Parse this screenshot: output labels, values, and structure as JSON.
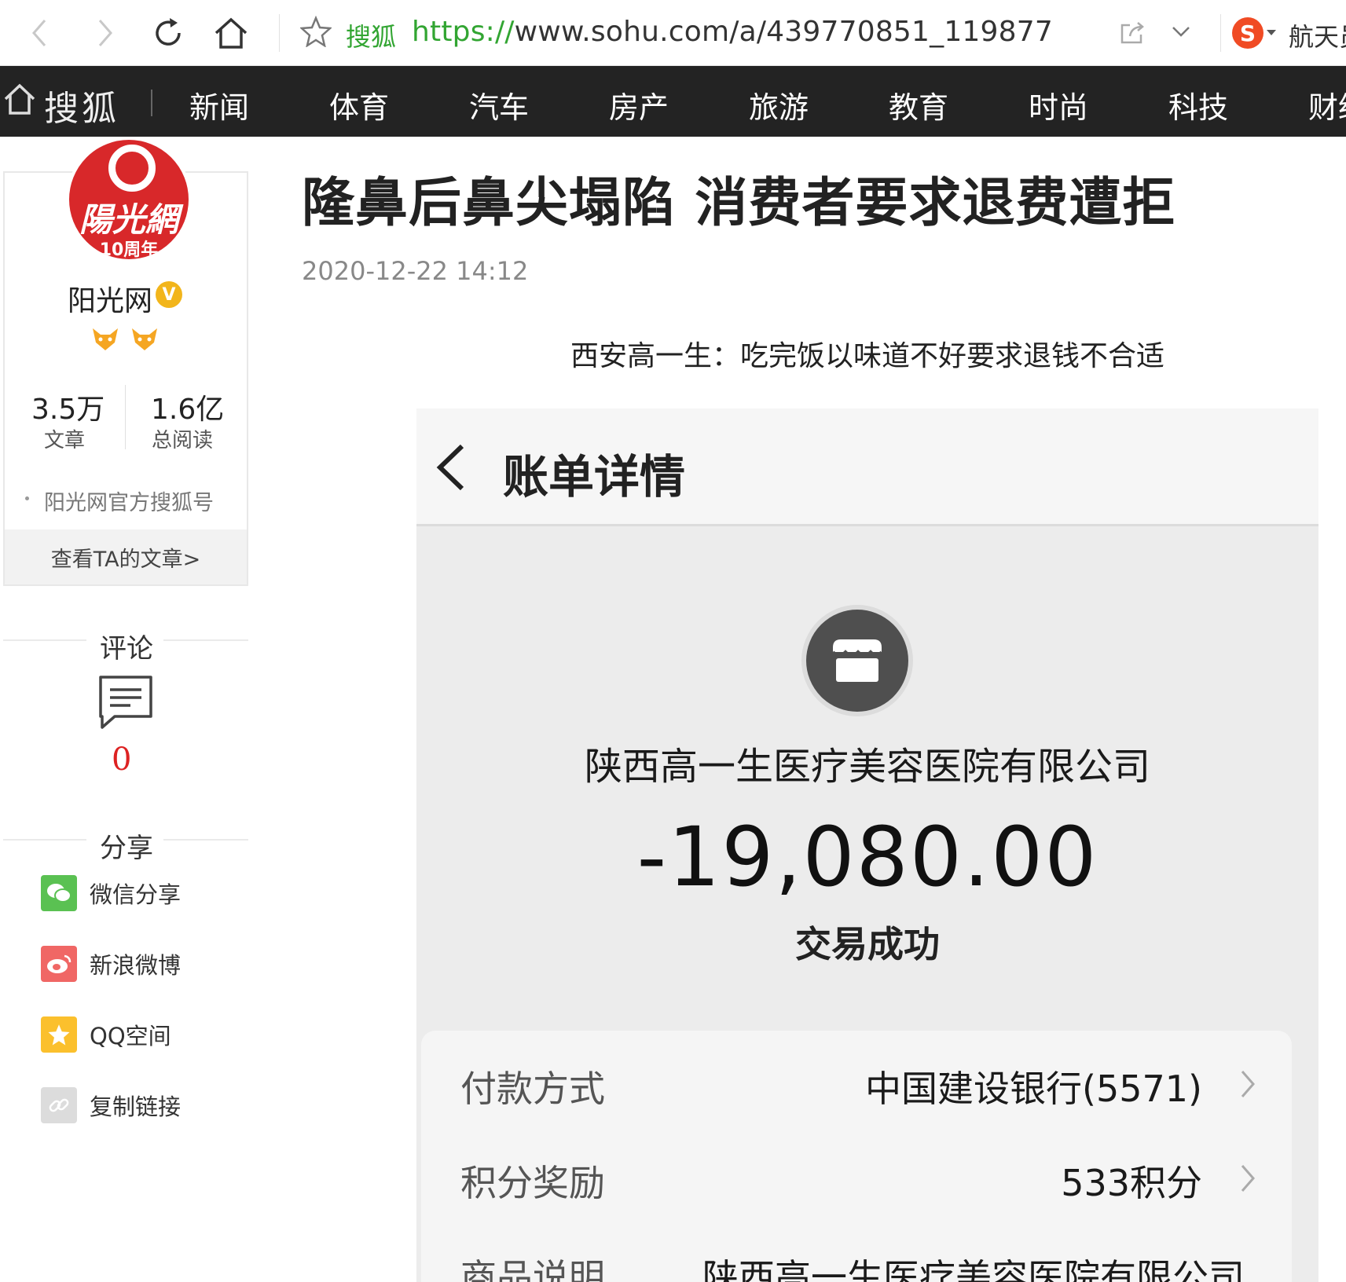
{
  "browser": {
    "site_name": "搜狐",
    "url_scheme": "https://",
    "url_rest": "www.sohu.com/a/439770851_119877",
    "search_hint": "航天员"
  },
  "nav": {
    "logo": "搜狐",
    "items": [
      "新闻",
      "体育",
      "汽车",
      "房产",
      "旅游",
      "教育",
      "时尚",
      "科技",
      "财经"
    ]
  },
  "author": {
    "logo_text": "陽光網",
    "logo_years": "10周年",
    "name": "阳光网",
    "verified_mark": "V",
    "articles_value": "3.5万",
    "articles_label": "文章",
    "reads_value": "1.6亿",
    "reads_label": "总阅读",
    "intro": "阳光网官方搜狐号",
    "see_more": "查看TA的文章>"
  },
  "comments": {
    "title": "评论",
    "count": "0"
  },
  "share": {
    "title": "分享",
    "items": [
      {
        "label": "微信分享",
        "color": "#5ac152"
      },
      {
        "label": "新浪微博",
        "color": "#f06765"
      },
      {
        "label": "QQ空间",
        "color": "#fbc02d"
      },
      {
        "label": "复制链接",
        "color": "#dcdcdc"
      }
    ]
  },
  "article": {
    "title": "隆鼻后鼻尖塌陷 消费者要求退费遭拒",
    "date": "2020-12-22 14:12",
    "caption": "西安高一生：吃完饭以味道不好要求退钱不合适"
  },
  "bill": {
    "header": "账单详情",
    "merchant": "陕西高一生医疗美容医院有限公司",
    "amount": "-19,080.00",
    "status": "交易成功",
    "rows": [
      {
        "label": "付款方式",
        "value": "中国建设银行(5571)"
      },
      {
        "label": "积分奖励",
        "value": "533积分"
      },
      {
        "label": "商品说明",
        "value": "陕西高一生医疗美容医院有限公司"
      }
    ]
  }
}
